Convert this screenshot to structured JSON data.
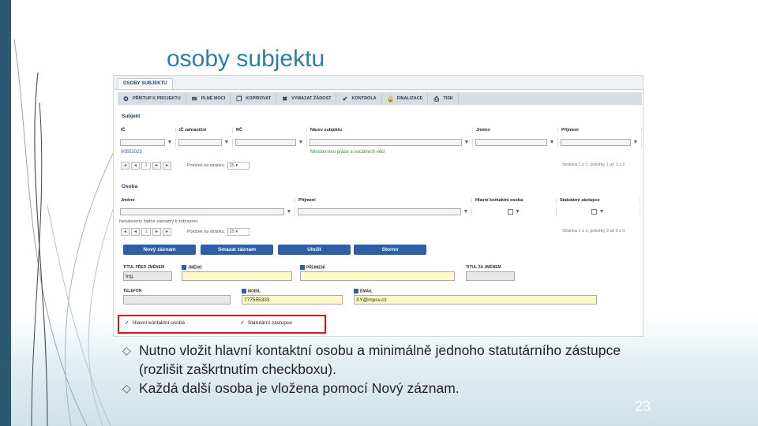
{
  "slide": {
    "title": "osoby subjektu",
    "page_number": "23",
    "colors": {
      "title": "#2d7fa7",
      "left_bar": "#2b5873",
      "button": "#2d5ea8",
      "highlight": "#d8141b"
    }
  },
  "screenshot": {
    "tab": "OSOBY SUBJEKTU",
    "toolbar": [
      {
        "label": "PŘÍSTUP K PROJEKTU",
        "icon": "access-icon"
      },
      {
        "label": "PLNÉ MOCI",
        "icon": "mail-icon"
      },
      {
        "label": "KOPÍROVAT",
        "icon": "copy-icon"
      },
      {
        "label": "VYMAZAT ŽÁDOST",
        "icon": "delete-icon"
      },
      {
        "label": "KONTROLA",
        "icon": "check-icon"
      },
      {
        "label": "FINALIZACE",
        "icon": "lock-icon"
      },
      {
        "label": "TISK",
        "icon": "print-icon"
      }
    ],
    "subjekt": {
      "section_title": "Subjekt",
      "columns": [
        "IČ",
        "IČ zahraniční",
        "RČ",
        "Název subjektu",
        "Jméno",
        "Příjmení"
      ],
      "row": {
        "ic": "00551023",
        "nazev": "Ministerstvo práce a sociálních věcí"
      },
      "pager": {
        "page": "1",
        "page_size": "25",
        "page_size_label": "Položek na stránku",
        "summary": "Stránka 1 z 1, položky 1 až 1 z 1"
      }
    },
    "osoba": {
      "section_title": "Osoba",
      "columns": [
        "Jméno",
        "Příjmení",
        "Hlavní kontaktní osoba",
        "Statutární zástupce"
      ],
      "empty_message": "Nenalezeny žádné záznamy k zobrazení",
      "pager": {
        "page": "1",
        "page_size": "25",
        "page_size_label": "Položek na stránku",
        "summary": "Stránka 1 z 1, položky 0 až 0 z 0"
      }
    },
    "buttons": [
      "Nový záznam",
      "Smazat záznam",
      "Uložit",
      "Storno"
    ],
    "form": {
      "titul_pred": {
        "label": "TITUL PŘED JMÉNEM",
        "value": "Ing."
      },
      "jmeno": {
        "label": "JMÉNO",
        "value": ""
      },
      "prijmeni": {
        "label": "PŘÍJMENÍ",
        "value": ""
      },
      "titul_za": {
        "label": "TITUL ZA JMÉNEM",
        "value": ""
      },
      "telefon": {
        "label": "TELEFON",
        "value": ""
      },
      "mobil": {
        "label": "MOBIL",
        "value": "777555333"
      },
      "email": {
        "label": "EMAIL",
        "value": "XY@mpsv.cz"
      },
      "hlavni_kontaktni": {
        "label": "Hlavní kontaktní osoba",
        "mark": "✓"
      },
      "statutarni": {
        "label": "Statutární zástupce",
        "mark": "✓"
      }
    }
  },
  "bullets": [
    "Nutno vložit hlavní kontaktní osobu a minimálně jednoho statutárního zástupce (rozlišit zaškrtnutím checkboxu).",
    "Každá další osoba je vložena pomocí Nový záznam."
  ]
}
